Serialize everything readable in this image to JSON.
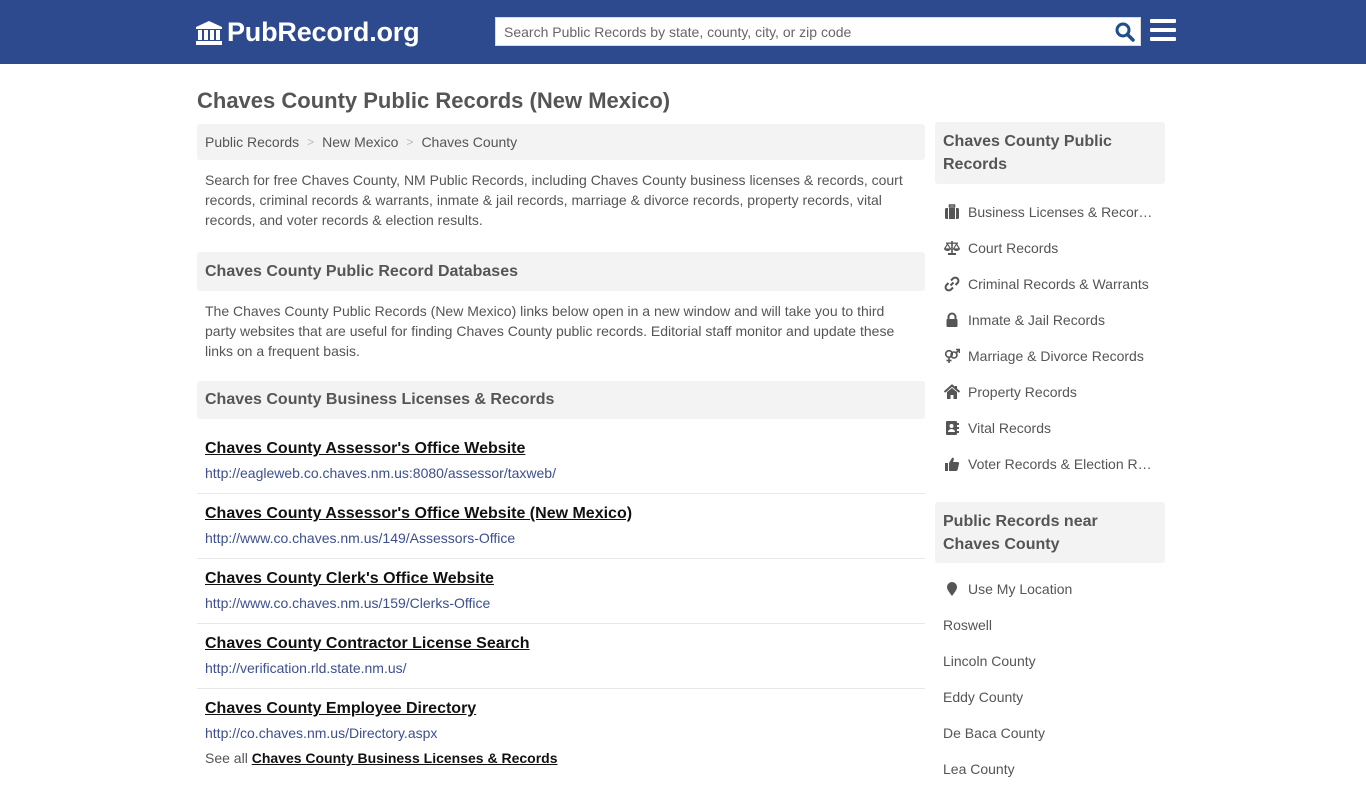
{
  "header": {
    "logo_text": "PubRecord.org",
    "logo_icon": "courthouse-icon",
    "search_placeholder": "Search Public Records by state, county, city, or zip code",
    "search_value": "",
    "search_icon": "search-icon",
    "menu_icon": "hamburger-menu-icon"
  },
  "colors": {
    "header_bg": "#2e4a8f",
    "search_icon": "#1f4e8c",
    "url_text": "#3d4f8f",
    "panel_bg": "#f3f3f3"
  },
  "page": {
    "title": "Chaves County Public Records (New Mexico)"
  },
  "breadcrumb": [
    {
      "label": "Public Records"
    },
    {
      "label": "New Mexico"
    },
    {
      "label": "Chaves County"
    }
  ],
  "intro": "Search for free Chaves County, NM Public Records, including Chaves County business licenses & records, court records, criminal records & warrants, inmate & jail records, marriage & divorce records, property records, vital records, and voter records & election results.",
  "databases": {
    "heading": "Chaves County Public Record Databases",
    "description": "The Chaves County Public Records (New Mexico) links below open in a new window and will take you to third party websites that are useful for finding Chaves County public records. Editorial staff monitor and update these links on a frequent basis."
  },
  "business": {
    "heading": "Chaves County Business Licenses & Records",
    "links": [
      {
        "title": "Chaves County Assessor's Office Website",
        "url": "http://eagleweb.co.chaves.nm.us:8080/assessor/taxweb/"
      },
      {
        "title": "Chaves County Assessor's Office Website (New Mexico)",
        "url": "http://www.co.chaves.nm.us/149/Assessors-Office"
      },
      {
        "title": "Chaves County Clerk's Office Website",
        "url": "http://www.co.chaves.nm.us/159/Clerks-Office"
      },
      {
        "title": "Chaves County Contractor License Search",
        "url": "http://verification.rld.state.nm.us/"
      },
      {
        "title": "Chaves County Employee Directory",
        "url": "http://co.chaves.nm.us/Directory.aspx"
      }
    ],
    "see_all_prefix": "See all",
    "see_all_link": "Chaves County Business Licenses & Records"
  },
  "sidebar": {
    "categories_heading": "Chaves County Public Records",
    "categories": [
      {
        "label": "Business Licenses & Records",
        "icon": "briefcase-icon"
      },
      {
        "label": "Court Records",
        "icon": "scale-balance-icon"
      },
      {
        "label": "Criminal Records & Warrants",
        "icon": "link-icon"
      },
      {
        "label": "Inmate & Jail Records",
        "icon": "lock-icon"
      },
      {
        "label": "Marriage & Divorce Records",
        "icon": "gender-symbols-icon"
      },
      {
        "label": "Property Records",
        "icon": "home-icon"
      },
      {
        "label": "Vital Records",
        "icon": "address-book-icon"
      },
      {
        "label": "Voter Records & Election Results",
        "icon": "thumbs-up-icon"
      }
    ],
    "nearby_heading": "Public Records near Chaves County",
    "use_location": "Use My Location",
    "use_location_icon": "map-marker-icon",
    "nearby": [
      {
        "label": "Roswell"
      },
      {
        "label": "Lincoln County"
      },
      {
        "label": "Eddy County"
      },
      {
        "label": "De Baca County"
      },
      {
        "label": "Lea County"
      }
    ]
  }
}
